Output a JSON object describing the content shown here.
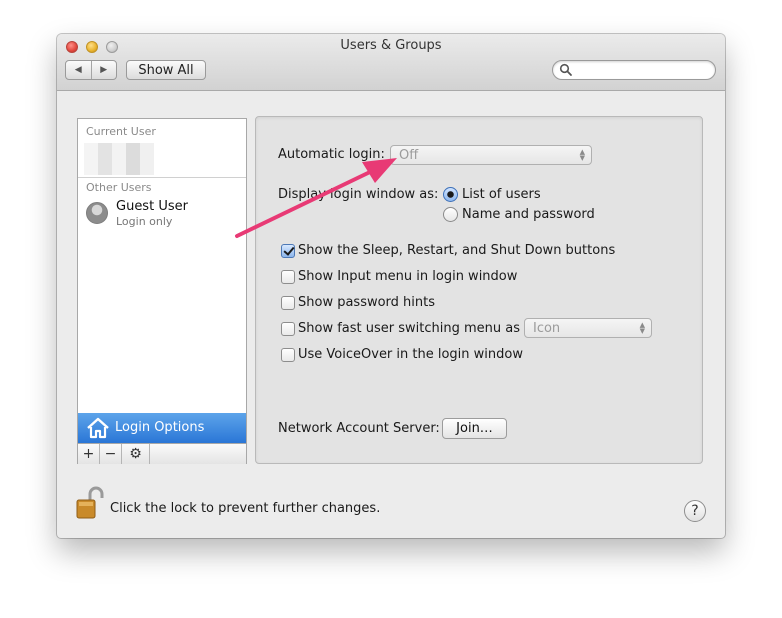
{
  "window": {
    "title": "Users & Groups"
  },
  "toolbar": {
    "back": "◀",
    "forward": "▶",
    "show_all": "Show All",
    "search_placeholder": ""
  },
  "sidebar": {
    "current_user_heading": "Current User",
    "other_users_heading": "Other Users",
    "guest": {
      "name": "Guest User",
      "subtitle": "Login only"
    },
    "login_options_label": "Login Options",
    "tools": {
      "add": "+",
      "remove": "−",
      "gear": "⚙"
    }
  },
  "panel": {
    "automatic_login": {
      "label": "Automatic login:",
      "value": "Off"
    },
    "display_login": {
      "label": "Display login window as:",
      "options": [
        {
          "label": "List of users",
          "selected": true
        },
        {
          "label": "Name and password",
          "selected": false
        }
      ]
    },
    "checkboxes": [
      {
        "label": "Show the Sleep, Restart, and Shut Down buttons",
        "checked": true
      },
      {
        "label": "Show Input menu in login window",
        "checked": false
      },
      {
        "label": "Show password hints",
        "checked": false
      },
      {
        "label": "Show fast user switching menu as",
        "checked": false
      },
      {
        "label": "Use VoiceOver in the login window",
        "checked": false
      }
    ],
    "fast_user_switching_value": "Icon",
    "network": {
      "label": "Network Account Server:",
      "button": "Join…"
    }
  },
  "footer": {
    "lock_text": "Click the lock to prevent further changes.",
    "help": "?"
  },
  "colors": {
    "selection": "#2a76d6",
    "annotation_arrow": "#e83a75"
  }
}
